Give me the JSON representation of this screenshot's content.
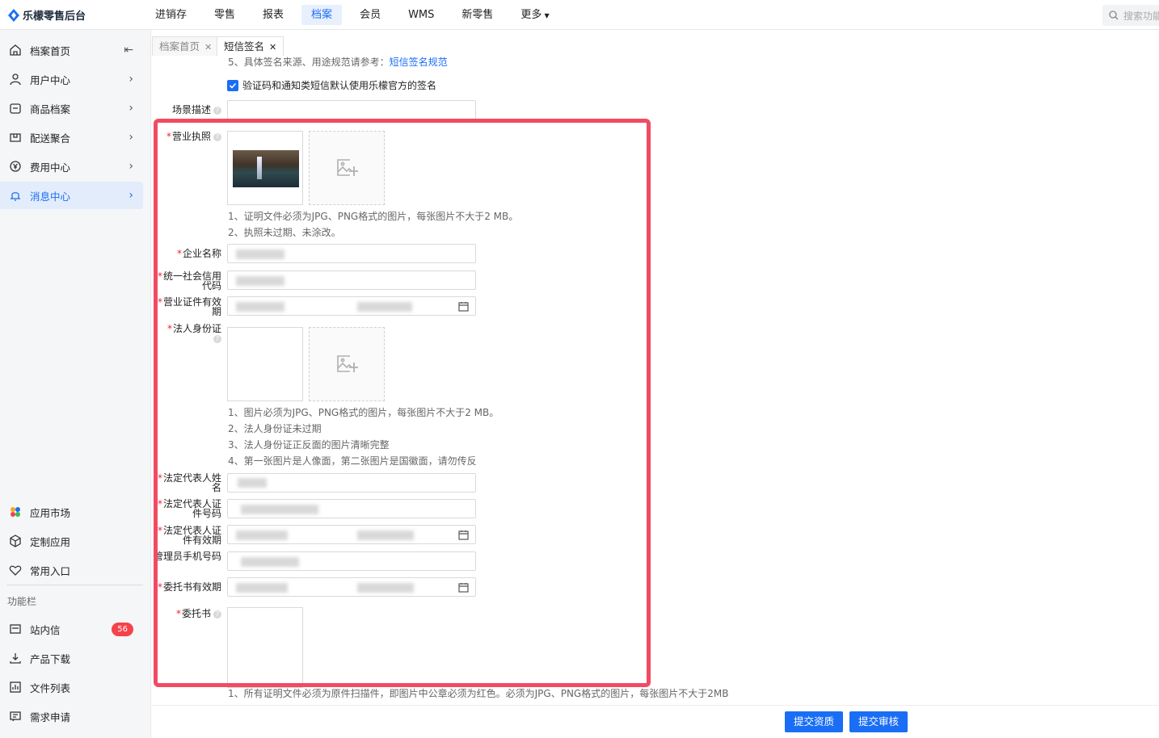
{
  "app": {
    "title": "乐檬零售后台"
  },
  "nav": {
    "items": [
      "进销存",
      "零售",
      "报表",
      "档案",
      "会员",
      "WMS",
      "新零售",
      "更多"
    ],
    "active_index": 3,
    "search_placeholder": "搜索功能"
  },
  "sidebar": {
    "items": [
      {
        "label": "档案首页",
        "icon": "home-icon"
      },
      {
        "label": "用户中心",
        "icon": "user-icon"
      },
      {
        "label": "商品档案",
        "icon": "product-icon"
      },
      {
        "label": "配送聚合",
        "icon": "delivery-icon"
      },
      {
        "label": "费用中心",
        "icon": "yuan-icon"
      },
      {
        "label": "消息中心",
        "icon": "bell-icon"
      }
    ],
    "bottom_items": [
      {
        "label": "应用市场",
        "icon": "app-market-icon"
      },
      {
        "label": "定制应用",
        "icon": "cube-icon"
      },
      {
        "label": "常用入口",
        "icon": "heart-icon"
      }
    ],
    "func_label": "功能栏",
    "func_items": [
      {
        "label": "站内信",
        "icon": "mail-icon",
        "badge": "56"
      },
      {
        "label": "产品下载",
        "icon": "download-icon"
      },
      {
        "label": "文件列表",
        "icon": "file-list-icon"
      },
      {
        "label": "需求申请",
        "icon": "request-icon"
      }
    ]
  },
  "tabs": [
    "档案首页",
    "短信签名"
  ],
  "form": {
    "note5_prefix": "5、具体签名来源、用途规范请参考：",
    "note5_link": "短信签名规范",
    "checkbox_label": "验证码和通知类短信默认使用乐檬官方的签名",
    "scene_label": "场景描述",
    "license_label": "营业执照",
    "license_notes": [
      "1、证明文件必须为JPG、PNG格式的图片，每张图片不大于2 MB。",
      "2、执照未过期、未涂改。"
    ],
    "company_label": "企业名称",
    "credit_code_label": "统一社会信用代码",
    "license_valid_label": "营业证件有效期",
    "legal_id_label": "法人身份证",
    "legal_id_notes": [
      "1、图片必须为JPG、PNG格式的图片，每张图片不大于2 MB。",
      "2、法人身份证未过期",
      "3、法人身份证正反面的图片清晰完整",
      "4、第一张图片是人像面，第二张图片是国徽面，请勿传反"
    ],
    "legal_name_label": "法定代表人姓名",
    "legal_id_no_label": "法定代表人证件号码",
    "legal_id_valid_label": "法定代表人证件有效期",
    "admin_phone_label": "管理员手机号码",
    "auth_valid_label": "委托书有效期",
    "auth_label": "委托书",
    "auth_note": "1、所有证明文件必须为原件扫描件，即图片中公章必须为红色。必须为JPG、PNG格式的图片，每张图片不大于2MB"
  },
  "buttons": {
    "submit_qual": "提交资质",
    "submit_review": "提交审核"
  }
}
